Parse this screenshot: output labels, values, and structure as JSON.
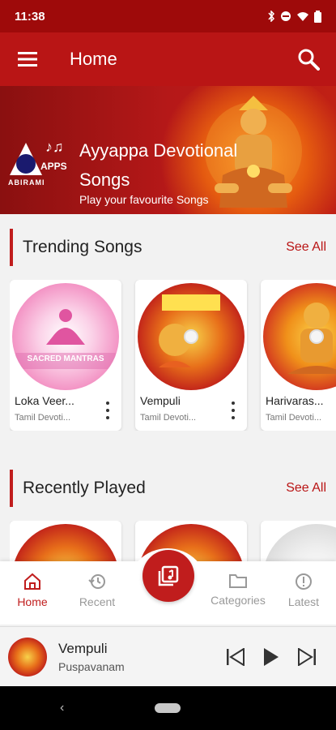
{
  "status_bar": {
    "time": "11:38"
  },
  "app_bar": {
    "title": "Home"
  },
  "banner": {
    "title_line1": "Ayyappa Devotional",
    "title_line2": "Songs",
    "subtitle": "Play your favourite Songs",
    "logo_apps": "APPS",
    "logo_name": "ABIRAMI"
  },
  "trending": {
    "title": "Trending Songs",
    "see_all": "See All",
    "items": [
      {
        "title": "Loka Veer...",
        "subtitle": "Tamil Devoti...",
        "art_text": "SACRED MANTRAS"
      },
      {
        "title": "Vempuli",
        "subtitle": "Tamil Devoti..."
      },
      {
        "title": "Harivaras...",
        "subtitle": "Tamil Devoti..."
      }
    ]
  },
  "recent": {
    "title": "Recently Played",
    "see_all": "See All"
  },
  "bottom_nav": {
    "items": [
      {
        "label": "Home"
      },
      {
        "label": "Recent"
      },
      {
        "label": "Categories"
      },
      {
        "label": "Latest"
      }
    ]
  },
  "mini_player": {
    "title": "Vempuli",
    "artist": "Puspavanam"
  },
  "colors": {
    "primary": "#b91515",
    "status_bar": "#9e0a0a",
    "accent": "#c01d1d"
  }
}
